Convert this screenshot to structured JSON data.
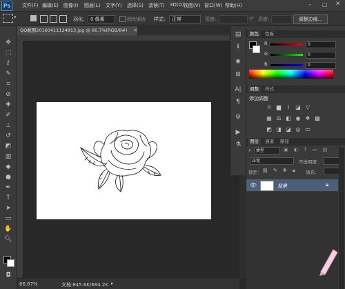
{
  "app": {
    "logo": "Ps"
  },
  "menu": [
    "文件(F)",
    "编辑(E)",
    "图像(I)",
    "图层(L)",
    "文字(Y)",
    "选择(S)",
    "滤镜(T)",
    "3D(D)",
    "视图(V)",
    "窗口(W)",
    "帮助(H)"
  ],
  "options": {
    "feather_label": "羽化:",
    "feather_value": "0 像素",
    "antialias_label": "消除锯齿",
    "style_label": "样式:",
    "style_value": "正常",
    "width_label": "宽度:",
    "height_label": "高度:",
    "refine_edge_button": "调整边缘..."
  },
  "document": {
    "tab_title": "QQ截图20160411124813.jpg @ 66.7%(RGB/8#)",
    "zoom": "66.67%",
    "doc_size": "文档:845.6K/684.2K"
  },
  "color_panel": {
    "tabs": [
      "颜色",
      "色板"
    ],
    "channels": [
      {
        "name": "R",
        "value": "0"
      },
      {
        "name": "G",
        "value": "0"
      },
      {
        "name": "B",
        "value": "0"
      }
    ]
  },
  "adjustments_panel": {
    "tabs": [
      "调整",
      "样式"
    ],
    "title": "添加调整"
  },
  "layers_panel": {
    "tabs": [
      "图层",
      "通道",
      "路径"
    ],
    "kind_filter": "类型",
    "blend_mode": "正常",
    "opacity_label": "不透明度:",
    "lock_label": "锁定:",
    "fill_label": "填充:",
    "layer_name": "背景"
  },
  "colors": {
    "accent": "#4d8fd1",
    "selected_layer": "#4d5e78"
  }
}
